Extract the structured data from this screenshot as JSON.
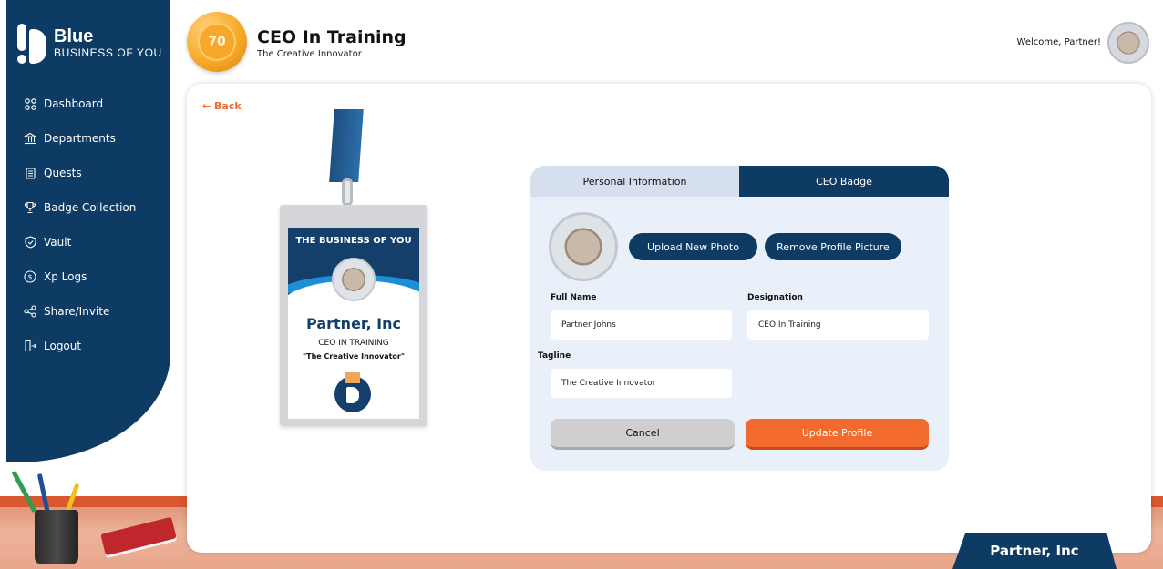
{
  "brand": {
    "title": "Blue",
    "subtitle": "BUSINESS OF YOU"
  },
  "sidebar": {
    "items": [
      {
        "label": "Dashboard",
        "icon": "grid-icon"
      },
      {
        "label": "Departments",
        "icon": "bank-icon"
      },
      {
        "label": "Quests",
        "icon": "scroll-icon"
      },
      {
        "label": "Badge Collection",
        "icon": "trophy-icon"
      },
      {
        "label": "Vault",
        "icon": "shield-icon"
      },
      {
        "label": "Xp Logs",
        "icon": "dollar-coin-icon"
      },
      {
        "label": "Share/Invite",
        "icon": "share-icon"
      },
      {
        "label": "Logout",
        "icon": "logout-icon"
      }
    ]
  },
  "header": {
    "level": "70",
    "title": "CEO In Training",
    "subtitle": "The Creative Innovator",
    "welcome": "Welcome, Partner!"
  },
  "page": {
    "back_label": "Back"
  },
  "badge_card": {
    "heading": "THE BUSINESS OF YOU",
    "name": "Partner, Inc",
    "role": "CEO IN TRAINING",
    "tagline": "\"The Creative Innovator\""
  },
  "form": {
    "tabs": [
      "Personal Information",
      "CEO Badge"
    ],
    "upload_label": "Upload New Photo",
    "remove_label": "Remove Profile Picture",
    "full_name_label": "Full Name",
    "full_name_value": "Partner Johns",
    "designation_label": "Designation",
    "designation_value": "CEO In Training",
    "tagline_label": "Tagline",
    "tagline_value": "The Creative Innovator",
    "cancel_label": "Cancel",
    "update_label": "Update Profile"
  },
  "desk": {
    "nameplate": "Partner, Inc"
  },
  "colors": {
    "primary": "#0e3b63",
    "accent": "#f26a2e",
    "panel": "#eaf0fa"
  }
}
